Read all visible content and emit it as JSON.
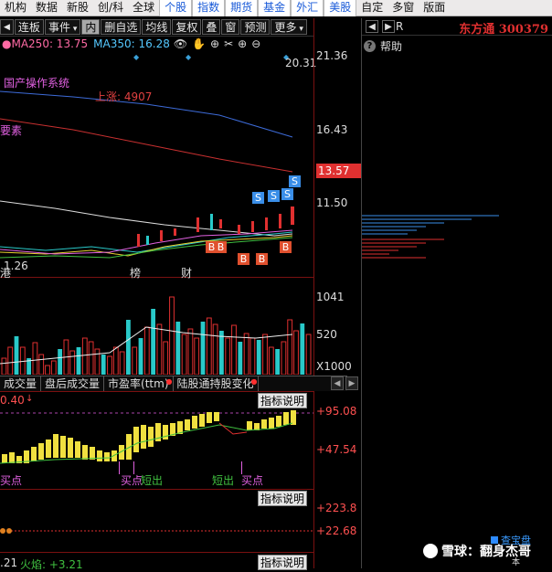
{
  "topnav": {
    "tabs": [
      "机构",
      "数据",
      "新股",
      "创/科",
      "全球",
      "个股",
      "指数",
      "期货",
      "基金",
      "外汇",
      "美股",
      "自定",
      "多窗",
      "版面"
    ],
    "highlighted": [
      "个股",
      "指数",
      "期货",
      "基金",
      "外汇",
      "美股"
    ]
  },
  "toolbar": {
    "items": [
      "连板",
      "事件",
      "内",
      "删自选",
      "均线",
      "复权",
      "叠",
      "窗",
      "预测",
      "更多"
    ],
    "selected": "内"
  },
  "ma": {
    "ma250_label": "MA250: 13.75",
    "ma350_label": "MA350: 16.28",
    "icon_names": [
      "eye-icon",
      "hand-icon",
      "crosshair-icon",
      "scissors-icon",
      "zoom-in-icon",
      "zoom-out-icon"
    ]
  },
  "stock": {
    "name_code": "东方通 300379",
    "right_letter": "R",
    "help": "帮助"
  },
  "main_chart": {
    "label_system": "国产操作系统",
    "label_rise": "上涨: 4907",
    "label_element": "要素",
    "label_gang": "港",
    "label_low": "1.26",
    "label_bang": "榜",
    "label_cai": "财",
    "top_value": "20.31",
    "price_axis": [
      "21.36",
      "16.43",
      "13.57",
      "11.50"
    ],
    "current_price": "13.57",
    "signal_S": "S",
    "signal_B": "B"
  },
  "volume": {
    "axis": [
      "1041",
      "520",
      "X1000"
    ],
    "bars": [
      {
        "h": 18,
        "c": "r"
      },
      {
        "h": 30,
        "c": "r"
      },
      {
        "h": 42,
        "c": "c"
      },
      {
        "h": 30,
        "c": "r"
      },
      {
        "h": 18,
        "c": "c"
      },
      {
        "h": 35,
        "c": "r"
      },
      {
        "h": 22,
        "c": "r"
      },
      {
        "h": 10,
        "c": "r"
      },
      {
        "h": 15,
        "c": "r"
      },
      {
        "h": 28,
        "c": "c"
      },
      {
        "h": 38,
        "c": "r"
      },
      {
        "h": 26,
        "c": "r"
      },
      {
        "h": 30,
        "c": "c"
      },
      {
        "h": 40,
        "c": "r"
      },
      {
        "h": 36,
        "c": "r"
      },
      {
        "h": 28,
        "c": "r"
      },
      {
        "h": 22,
        "c": "c"
      },
      {
        "h": 20,
        "c": "r"
      },
      {
        "h": 30,
        "c": "r"
      },
      {
        "h": 25,
        "c": "r"
      },
      {
        "h": 60,
        "c": "c"
      },
      {
        "h": 30,
        "c": "r"
      },
      {
        "h": 40,
        "c": "c"
      },
      {
        "h": 52,
        "c": "r"
      },
      {
        "h": 72,
        "c": "c"
      },
      {
        "h": 55,
        "c": "r"
      },
      {
        "h": 36,
        "c": "r"
      },
      {
        "h": 85,
        "c": "r"
      },
      {
        "h": 58,
        "c": "c"
      },
      {
        "h": 44,
        "c": "r"
      },
      {
        "h": 50,
        "c": "r"
      },
      {
        "h": 40,
        "c": "r"
      },
      {
        "h": 58,
        "c": "c"
      },
      {
        "h": 62,
        "c": "r"
      },
      {
        "h": 55,
        "c": "r"
      },
      {
        "h": 48,
        "c": "c"
      },
      {
        "h": 40,
        "c": "r"
      },
      {
        "h": 54,
        "c": "r"
      },
      {
        "h": 36,
        "c": "c"
      },
      {
        "h": 45,
        "c": "r"
      },
      {
        "h": 40,
        "c": "r"
      },
      {
        "h": 38,
        "c": "c"
      },
      {
        "h": 44,
        "c": "r"
      },
      {
        "h": 30,
        "c": "r"
      },
      {
        "h": 28,
        "c": "c"
      },
      {
        "h": 36,
        "c": "r"
      },
      {
        "h": 60,
        "c": "r"
      },
      {
        "h": 48,
        "c": "r"
      },
      {
        "h": 56,
        "c": "c"
      },
      {
        "h": 44,
        "c": "r"
      }
    ]
  },
  "indicator_tabs": [
    "成交量",
    "盘后成交量",
    "市盈率(ttm)",
    "陆股通持股变化"
  ],
  "indicator1": {
    "top_left": "0.40",
    "axis": [
      "+95.08",
      "+47.54"
    ],
    "explain": "指标说明",
    "buy_label": "买点",
    "short_label": "短出"
  },
  "indicator2": {
    "explain": "指标说明",
    "axis": [
      "+223.8",
      "+22.68"
    ]
  },
  "indicator3": {
    "explain": "指标说明",
    "bottom_left": ".21",
    "fire_label": "火焰: +3.21"
  },
  "watermark": {
    "text": "雪球：翻身杰哥",
    "tag": "查宝盘",
    "tag2": "本"
  }
}
